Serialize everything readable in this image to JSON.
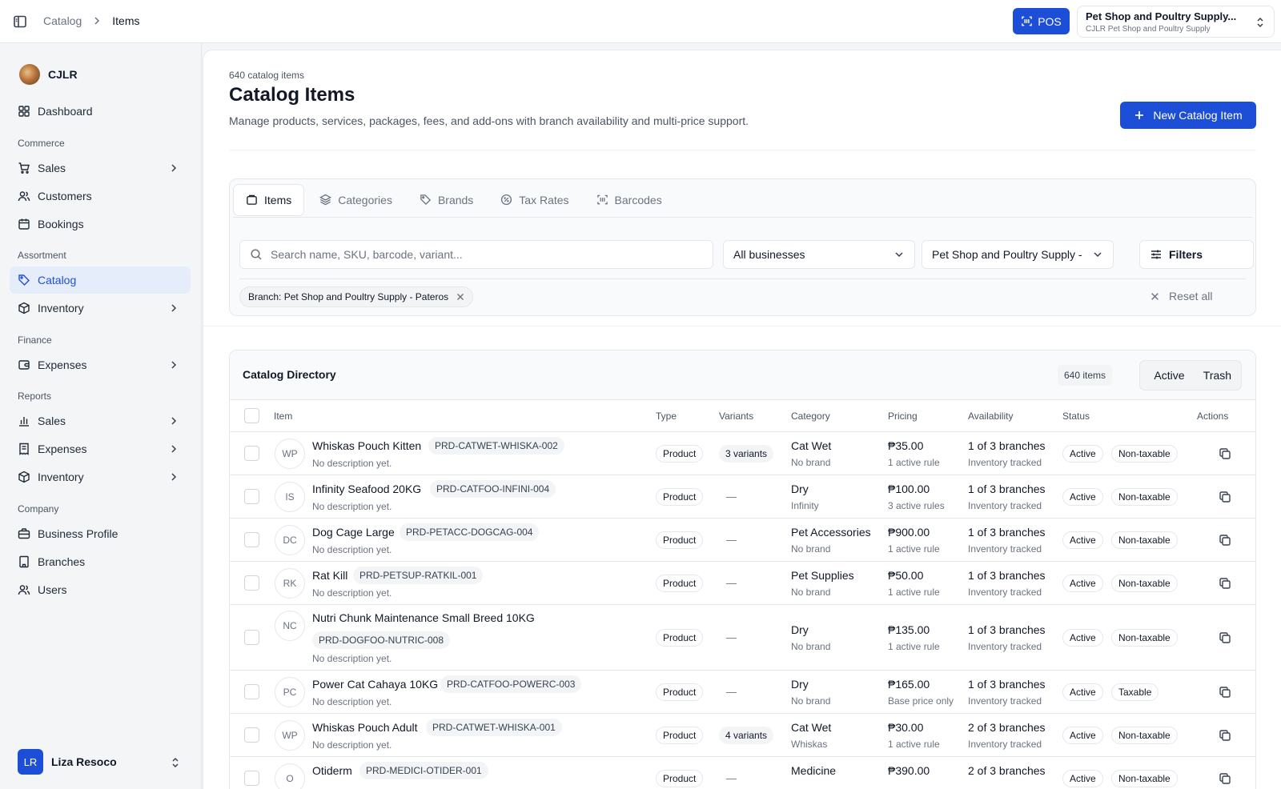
{
  "topbar": {
    "breadcrumb": [
      "Catalog",
      "Items"
    ],
    "pos_label": "POS",
    "business_name": "Pet Shop and Poultry Supply...",
    "business_sub": "CJLR Pet Shop and Poultry Supply"
  },
  "sidebar": {
    "org_name": "CJLR",
    "groups": {
      "commerce": "Commerce",
      "assortment": "Assortment",
      "finance": "Finance",
      "reports": "Reports",
      "company": "Company"
    },
    "items": {
      "dashboard": "Dashboard",
      "sales": "Sales",
      "customers": "Customers",
      "bookings": "Bookings",
      "catalog": "Catalog",
      "inventory": "Inventory",
      "expenses": "Expenses",
      "report_sales": "Sales",
      "report_expenses": "Expenses",
      "report_inventory": "Inventory",
      "business_profile": "Business Profile",
      "branches": "Branches",
      "users": "Users"
    },
    "user": {
      "initials": "LR",
      "name": "Liza Resoco"
    }
  },
  "header": {
    "count_label": "640 catalog items",
    "title": "Catalog Items",
    "description": "Manage products, services, packages, fees, and add-ons with branch availability and multi-price support.",
    "new_button": "New Catalog Item"
  },
  "tabs": [
    "Items",
    "Categories",
    "Brands",
    "Tax Rates",
    "Barcodes"
  ],
  "filters": {
    "search_placeholder": "Search name, SKU, barcode, variant...",
    "business_select": "All businesses",
    "branch_select": "Pet Shop and Poultry Supply -",
    "filters_button": "Filters",
    "chip": "Branch: Pet Shop and Poultry Supply - Pateros",
    "reset": "Reset all"
  },
  "directory": {
    "title": "Catalog Directory",
    "count": "640 items",
    "toggle": [
      "Active",
      "Trash"
    ],
    "columns": [
      "Item",
      "Type",
      "Variants",
      "Category",
      "Pricing",
      "Availability",
      "Status",
      "Actions"
    ],
    "rows": [
      {
        "initials": "WP",
        "name": "Whiskas Pouch Kitten",
        "sku": "PRD-CATWET-WHISKA-002",
        "desc": "No description yet.",
        "type": "Product",
        "variants": "3 variants",
        "category": "Cat Wet",
        "brand": "No brand",
        "price": "₱35.00",
        "rule": "1 active rule",
        "avail": "1 of 3 branches",
        "tracking": "Inventory tracked",
        "status": "Active",
        "tax": "Non-taxable"
      },
      {
        "initials": "IS",
        "name": "Infinity Seafood 20KG",
        "sku": "PRD-CATFOO-INFINI-004",
        "desc": "No description yet.",
        "type": "Product",
        "variants": "—",
        "category": "Dry",
        "brand": "Infinity",
        "price": "₱100.00",
        "rule": "3 active rules",
        "avail": "1 of 3 branches",
        "tracking": "Inventory tracked",
        "status": "Active",
        "tax": "Non-taxable"
      },
      {
        "initials": "DC",
        "name": "Dog Cage Large",
        "sku": "PRD-PETACC-DOGCAG-004",
        "desc": "No description yet.",
        "type": "Product",
        "variants": "—",
        "category": "Pet Accessories",
        "brand": "No brand",
        "price": "₱900.00",
        "rule": "1 active rule",
        "avail": "1 of 3 branches",
        "tracking": "Inventory tracked",
        "status": "Active",
        "tax": "Non-taxable"
      },
      {
        "initials": "RK",
        "name": "Rat Kill",
        "sku": "PRD-PETSUP-RATKIL-001",
        "desc": "No description yet.",
        "type": "Product",
        "variants": "—",
        "category": "Pet Supplies",
        "brand": "No brand",
        "price": "₱50.00",
        "rule": "1 active rule",
        "avail": "1 of 3 branches",
        "tracking": "Inventory tracked",
        "status": "Active",
        "tax": "Non-taxable"
      },
      {
        "initials": "NC",
        "name": "Nutri Chunk Maintenance Small Breed 10KG",
        "sku": "PRD-DOGFOO-NUTRIC-008",
        "desc": "No description yet.",
        "type": "Product",
        "variants": "—",
        "category": "Dry",
        "brand": "No brand",
        "price": "₱135.00",
        "rule": "1 active rule",
        "avail": "1 of 3 branches",
        "tracking": "Inventory tracked",
        "status": "Active",
        "tax": "Non-taxable"
      },
      {
        "initials": "PC",
        "name": "Power Cat Cahaya 10KG",
        "sku": "PRD-CATFOO-POWERC-003",
        "desc": "No description yet.",
        "type": "Product",
        "variants": "—",
        "category": "Dry",
        "brand": "No brand",
        "price": "₱165.00",
        "rule": "Base price only",
        "avail": "1 of 3 branches",
        "tracking": "Inventory tracked",
        "status": "Active",
        "tax": "Taxable"
      },
      {
        "initials": "WP",
        "name": "Whiskas Pouch Adult",
        "sku": "PRD-CATWET-WHISKA-001",
        "desc": "No description yet.",
        "type": "Product",
        "variants": "4 variants",
        "category": "Cat Wet",
        "brand": "Whiskas",
        "price": "₱30.00",
        "rule": "1 active rule",
        "avail": "2 of 3 branches",
        "tracking": "Inventory tracked",
        "status": "Active",
        "tax": "Non-taxable"
      },
      {
        "initials": "O",
        "name": "Otiderm",
        "sku": "PRD-MEDICI-OTIDER-001",
        "desc": "",
        "type": "Product",
        "variants": "—",
        "category": "Medicine",
        "brand": "",
        "price": "₱390.00",
        "rule": "",
        "avail": "2 of 3 branches",
        "tracking": "",
        "status": "Active",
        "tax": "Non-taxable"
      }
    ]
  }
}
